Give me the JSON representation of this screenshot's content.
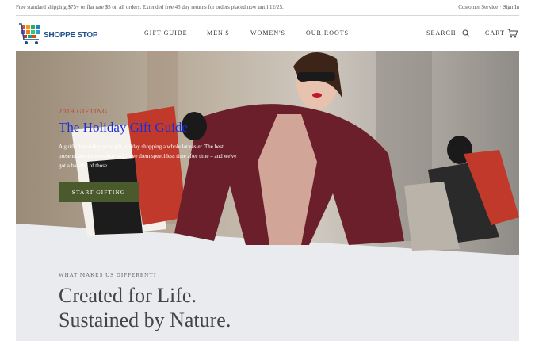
{
  "topbar": {
    "promo": "Free standard shipping $75+ or flat rate $5 on all orders. Extended free 45 day returns for orders placed now until 12/25.",
    "customer_service": "Customer Service",
    "sign_in": "Sign In"
  },
  "header": {
    "logo_text": "SHOPPE STOP",
    "nav": [
      {
        "label": "GIFT GUIDE"
      },
      {
        "label": "MEN'S"
      },
      {
        "label": "WOMEN'S"
      },
      {
        "label": "OUR ROOTS"
      }
    ],
    "search_label": "SEARCH",
    "cart_label": "CART"
  },
  "hero": {
    "eyebrow": "2019 GIFTING",
    "title": "The Holiday Gift Guide",
    "description": "A guide that makes your gift holiday shopping a whole lot easier. The best presents are the ones that will leave them speechless time after time – and we've got a handful of those.",
    "cta_label": "START GIFTING"
  },
  "difference": {
    "label": "WHAT MAKES US DIFFERENT?",
    "title_line1": "Created for Life.",
    "title_line2": "Sustained by Nature."
  },
  "colors": {
    "eyebrow": "#c0392b",
    "hero_title": "#1a2fd9",
    "cta_background": "#4b5a2c",
    "section_background": "#e9ebee"
  }
}
